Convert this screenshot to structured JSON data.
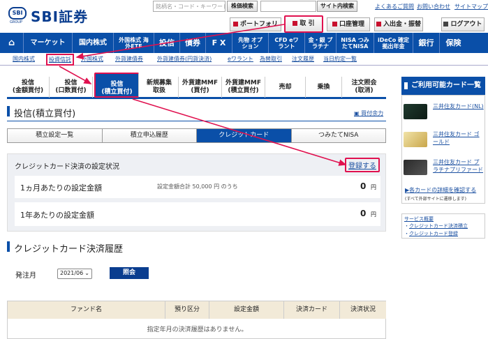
{
  "logo": {
    "badge": "SBI",
    "sub": "GROUP",
    "name": "SBI証券"
  },
  "header": {
    "search1_placeholder": "銘柄名・コード・キーワード",
    "search1_btn": "株価検索",
    "search2_btn": "サイト内検索",
    "links": [
      "よくあるご質問",
      "お問い合わせ",
      "サイトマップ"
    ],
    "portfolio": "ポートフォリオ",
    "trade": "取 引",
    "account": "口座管理",
    "transfer": "入出金・振替",
    "logout": "ログアウト"
  },
  "nav": [
    "マーケット",
    "国内株式",
    "外国株式 海外ETF",
    "投信",
    "債券",
    "F X",
    "先物 オプション",
    "CFD eワラント",
    "金・銀 プラチナ",
    "NISA つみたてNISA",
    "iDeCo 確定拠出年金",
    "銀行",
    "保険"
  ],
  "subnav": [
    "国内株式",
    "投資信託",
    "外国株式",
    "外貨建債券",
    "外貨建債券(円貨決済)",
    "eワラント",
    "為替取引",
    "注文履歴",
    "当日約定一覧"
  ],
  "product_tabs": [
    {
      "l1": "投信",
      "l2": "(金額買付)"
    },
    {
      "l1": "投信",
      "l2": "(口数買付)"
    },
    {
      "l1": "投信",
      "l2": "(積立買付)"
    },
    {
      "l1": "新規募集",
      "l2": "取扱"
    },
    {
      "l1": "外貨建MMF",
      "l2": "(買付)"
    },
    {
      "l1": "外貨建MMF",
      "l2": "(積立買付)"
    },
    {
      "l1": "売却",
      "l2": ""
    },
    {
      "l1": "乗換",
      "l2": ""
    },
    {
      "l1": "注文照会",
      "l2": "(取消)"
    }
  ],
  "page": {
    "title": "投信(積立買付)",
    "side_link": "買付余力"
  },
  "sub_tabs": [
    "積立設定一覧",
    "積立申込履歴",
    "クレジットカード",
    "つみたてNISA"
  ],
  "credit_status": {
    "title": "クレジットカード決済の設定状況",
    "register": "登録する",
    "monthly_label": "1ヵ月あたりの設定金額",
    "monthly_note": "設定金額合計 50,000 円 のうち",
    "monthly_value": "0",
    "yearly_label": "1年あたりの設定金額",
    "yearly_value": "0",
    "unit": "円"
  },
  "history": {
    "title": "クレジットカード決済履歴",
    "month_label": "発注月",
    "month_value": "2021/06",
    "query_btn": "照会",
    "columns": [
      "ファンド名",
      "預り区分",
      "設定金額",
      "決済カード",
      "決済状況"
    ],
    "empty": "指定年月の決済履歴はありません。"
  },
  "sidebar": {
    "title": "ご利用可能カード一覧",
    "cards": [
      "三井住友カード(NL)",
      "三井住友カード ゴールド",
      "三井住友カード プラチナプリファード"
    ],
    "detail_link": "各カードの詳細を確認する",
    "detail_note": "(すべて外部サイトに遷移します)",
    "overview_btn": "サービス概要",
    "links": [
      "クレジットカード決済積立",
      "クレジットカード登録"
    ]
  },
  "colors": {
    "brand": "#0a4fa8",
    "highlight": "#e0114f"
  }
}
